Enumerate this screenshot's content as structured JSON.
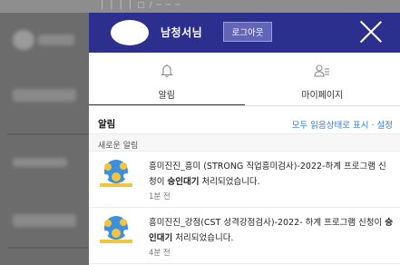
{
  "background": {
    "ghost_text": "│ │ │ │ □ / ─ ─ ─"
  },
  "header": {
    "username": "남청서님",
    "logout_label": "로그아웃"
  },
  "tabs": [
    {
      "label": "알림",
      "icon": "bell-icon",
      "active": true
    },
    {
      "label": "마이페이지",
      "icon": "user-list-icon",
      "active": false
    }
  ],
  "notifications": {
    "title": "알림",
    "mark_all_label": "모두 읽음상태로 표시 · 설정",
    "new_label": "새로운 알림",
    "items": [
      {
        "text_before": "흥미진진_흥미 (STRONG 직업흥미검사)-2022-하계 프로그램 신청이 ",
        "status": "승인대기",
        "text_after": " 처리되었습니다.",
        "time": "1분 전"
      },
      {
        "text_before": "흥미진진_강점(CST 성격강점검사)-2022- 하계 프로그램 신청이 ",
        "status": "승인대기",
        "text_after": " 처리되었습니다.",
        "time": "4분 전"
      }
    ]
  },
  "colors": {
    "header_bg": "#2d2f8f",
    "link": "#2f7fd0",
    "thumb_blue": "#3a8fe0",
    "thumb_yellow": "#f2c53d"
  }
}
